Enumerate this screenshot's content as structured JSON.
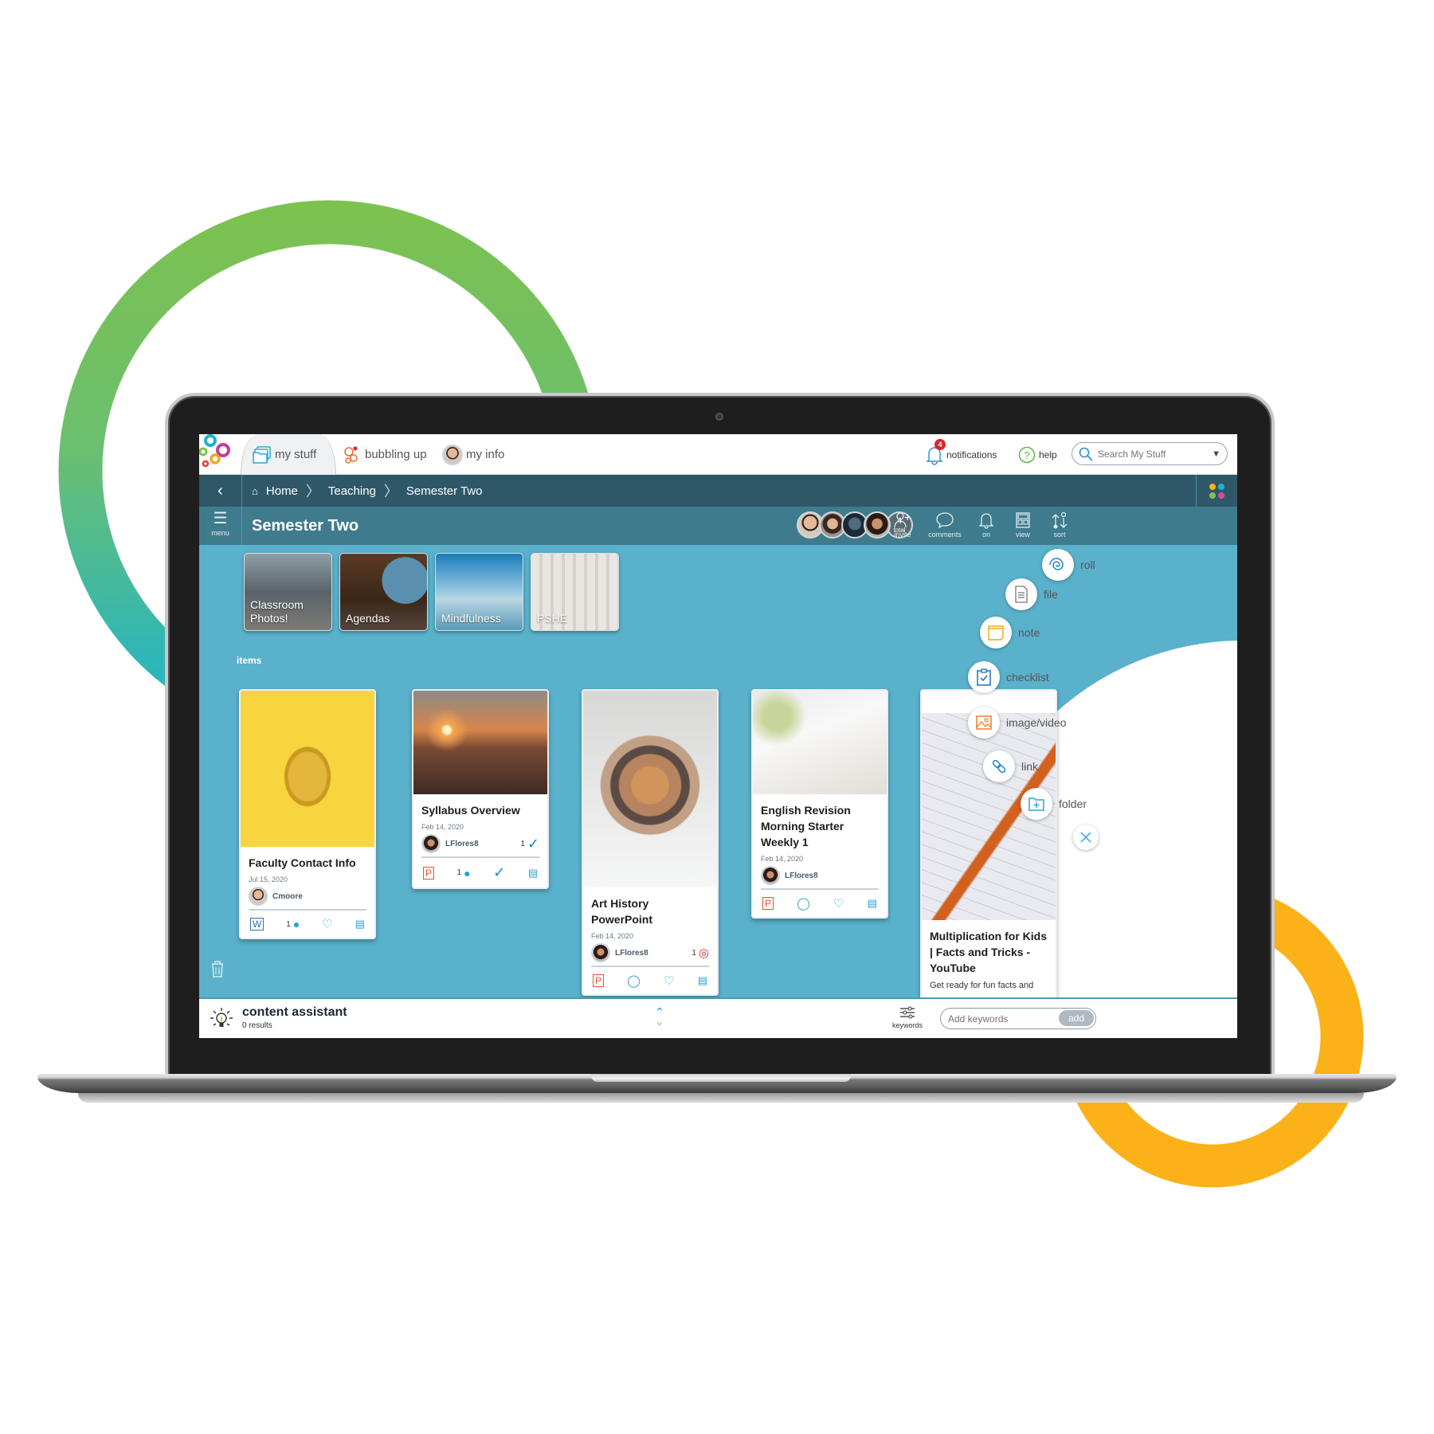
{
  "colors": {
    "green_ring": "#7dc24e",
    "teal_ring": "#1fb1c9",
    "orange_ring": "#fbb118",
    "nav_dark": "#2e5868",
    "title_bar": "#3e7b8d",
    "content_bg": "#5ab1cb",
    "badge_red": "#e0242b"
  },
  "topnav": {
    "tabs": [
      {
        "label": "my stuff",
        "icon": "folders-icon",
        "active": true
      },
      {
        "label": "bubbling up",
        "icon": "bubbles-icon",
        "active": false
      },
      {
        "label": "my info",
        "icon": "avatar",
        "active": false
      }
    ],
    "notifications": {
      "label": "notifications",
      "count": "4"
    },
    "help": {
      "label": "help"
    },
    "search": {
      "placeholder": "Search My Stuff"
    }
  },
  "breadcrumb": {
    "items": [
      "Home",
      "Teaching",
      "Semester Two"
    ]
  },
  "titlebar": {
    "menu_label": "menu",
    "title": "Semester Two",
    "members_total": "4",
    "members_total_label": "total",
    "actions": [
      {
        "label": "invite",
        "icon": "invite-icon"
      },
      {
        "label": "comments",
        "icon": "comments-icon"
      },
      {
        "label": "on",
        "icon": "bell-icon"
      },
      {
        "label": "view",
        "icon": "view-icon"
      },
      {
        "label": "sort",
        "icon": "sort-icon"
      }
    ]
  },
  "folders": [
    {
      "label": "Classroom Photos!"
    },
    {
      "label": "Agendas"
    },
    {
      "label": "Mindfulness"
    },
    {
      "label": "PSHE"
    }
  ],
  "items_label": "items",
  "cards": [
    {
      "title": "Faculty Contact Info",
      "date": "Jul 15, 2020",
      "owner": "Cmoore",
      "type": "word",
      "comments": "1",
      "badge": ""
    },
    {
      "title": "Syllabus Overview",
      "date": "Feb 14, 2020",
      "owner": "LFlores8",
      "type": "powerpoint",
      "comments": "1",
      "badge": "1"
    },
    {
      "title": "Art History PowerPoint",
      "date": "Feb 14, 2020",
      "owner": "LFlores8",
      "type": "powerpoint",
      "comments": "",
      "badge": "1"
    },
    {
      "title": "English Revision Morning Starter Weekly 1",
      "date": "Feb 14, 2020",
      "owner": "LFlores8",
      "type": "powerpoint",
      "comments": "",
      "badge": ""
    },
    {
      "title": "Multiplication for Kids | Facts and Tricks - YouTube",
      "description": "Get ready for fun facts and"
    }
  ],
  "add_menu": [
    {
      "label": "roll",
      "icon": "roll-icon"
    },
    {
      "label": "file",
      "icon": "file-icon"
    },
    {
      "label": "note",
      "icon": "note-icon"
    },
    {
      "label": "checklist",
      "icon": "checklist-icon"
    },
    {
      "label": "image/video",
      "icon": "image-icon"
    },
    {
      "label": "link",
      "icon": "link-icon"
    },
    {
      "label": "folder",
      "icon": "folder-add-icon"
    }
  ],
  "content_assistant": {
    "title": "content assistant",
    "results": "0 results",
    "keywords_label": "keywords",
    "keywords_placeholder": "Add keywords",
    "add_label": "add"
  }
}
